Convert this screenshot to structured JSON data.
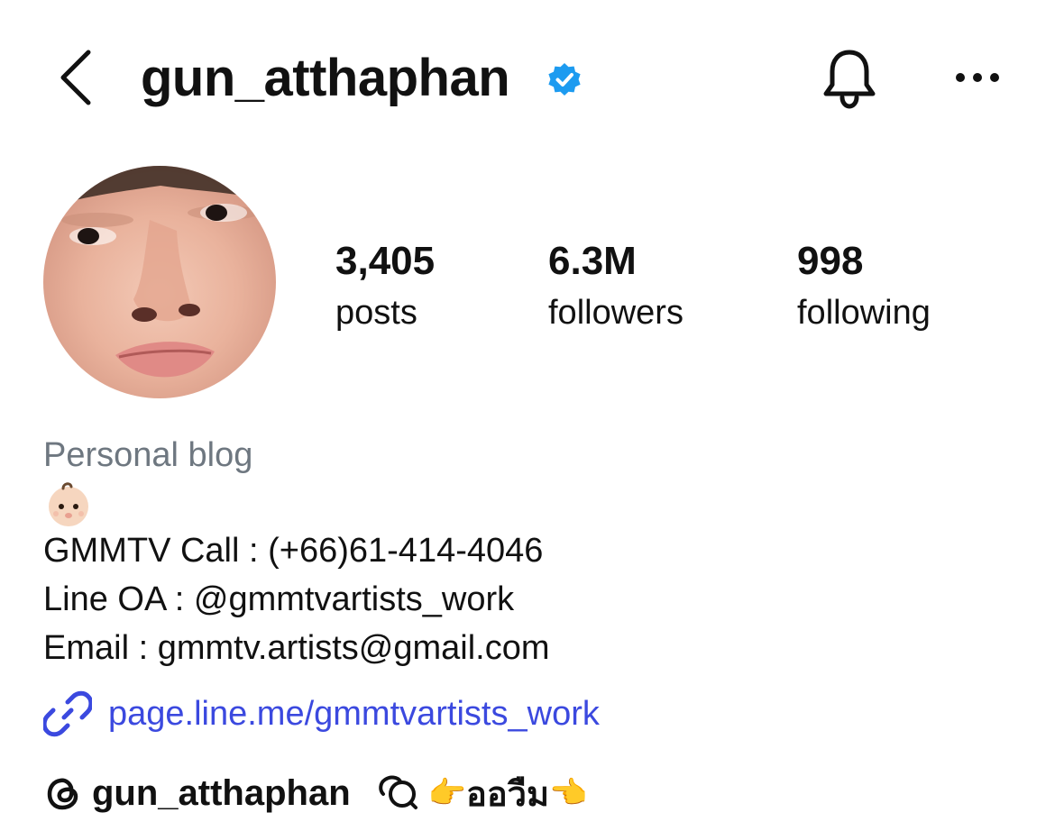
{
  "header": {
    "username": "gun_atthaphan",
    "verified_color": "#1d9bf0"
  },
  "stats": [
    {
      "value": "3,405",
      "label": "posts"
    },
    {
      "value": "6.3M",
      "label": "followers"
    },
    {
      "value": "998",
      "label": "following"
    }
  ],
  "bio": {
    "category": "Personal blog",
    "lines": [
      "GMMTV Call : (+66)61-414-4046",
      "Line OA : @gmmtvartists_work",
      "Email : gmmtv.artists@gmail.com"
    ],
    "link": "page.line.me/gmmtvartists_work",
    "link_color": "#3b49df"
  },
  "threads": {
    "handle": "gun_atthaphan",
    "text": "ออวืม"
  },
  "icons": {
    "back": "chevron-left-icon",
    "verified": "verified-badge-icon",
    "bell": "bell-icon",
    "more": "more-horizontal-icon",
    "link": "link-icon",
    "threads": "threads-logo-icon",
    "chat": "chat-bubbles-icon",
    "baby": "baby-face-emoji",
    "hand_right": "pointing-right-emoji",
    "hand_left": "pointing-left-emoji"
  }
}
